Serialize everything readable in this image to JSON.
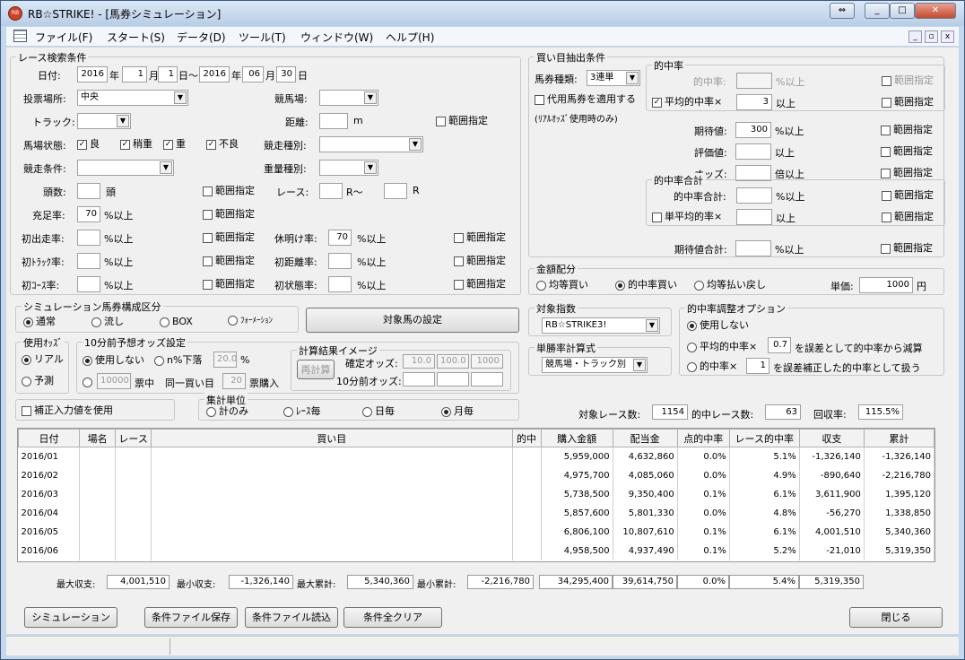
{
  "window": {
    "title": "RB☆STRIKE! - [馬券シミュレーション]",
    "app_icon": "RB"
  },
  "menu": [
    "ファイル(F)",
    "スタート(S)",
    "データ(D)",
    "ツール(T)",
    "ウィンドウ(W)",
    "ヘルプ(H)"
  ],
  "race": {
    "group": "レース検索条件",
    "date_label": "日付:",
    "y1": "2016",
    "y": "年",
    "m1": "1",
    "m": "月",
    "d1": "1",
    "d_range": "日～",
    "y2": "2016",
    "m2": "06",
    "d2": "30",
    "d": "日",
    "venue_label": "投票場所:",
    "venue": "中央",
    "track_label": "競馬場:",
    "course_label": "トラック:",
    "distance_label": "距離:",
    "distance_unit": "m",
    "range": "範囲指定",
    "condition_label": "馬場状態:",
    "cond_good": "良",
    "cond_slightly_heavy": "稍重",
    "cond_heavy": "重",
    "cond_bad": "不良",
    "type_label": "競走種別:",
    "race_cond_label": "競走条件:",
    "weight_label": "重量種別:",
    "heads_label": "頭数:",
    "heads_unit": "頭",
    "race_label": "レース:",
    "race_from_unit": "R～",
    "race_to_unit": "R",
    "fill_label": "充足率:",
    "fill_value": "70",
    "pct_over": "%以上",
    "first_run_label": "初出走率:",
    "layoff_label": "休明け率:",
    "layoff_value": "70",
    "first_track_label": "初ﾄﾗｯｸ率:",
    "first_dist_label": "初距離率:",
    "first_course_label": "初ｺｰｽ率:",
    "first_cond_label": "初状態率:"
  },
  "sim_comp": {
    "group": "シミュレーション馬券構成区分",
    "options": [
      "通常",
      "流し",
      "BOX",
      "ﾌｫｰﾒｰｼｮﾝ"
    ],
    "selected": 0,
    "target_btn": "対象馬の設定"
  },
  "odds_use": {
    "group": "使用ｵｯｽﾞ",
    "options": [
      "リアル",
      "予測"
    ],
    "selected": 0
  },
  "odds10": {
    "group": "10分前予想オッズ設定",
    "unused": "使用しない",
    "drop_label": "n%下落",
    "drop_value": "20.0",
    "drop_unit": "%",
    "amount": "10000",
    "in_label": "票中",
    "same_label": "同一買い目",
    "same_value": "20",
    "buy_label": "票購入"
  },
  "calc_img": {
    "group": "計算結果イメージ",
    "recalc": "再計算",
    "confirmed_label": "確定オッズ:",
    "confirmed": [
      "10.0",
      "100.0",
      "1000"
    ],
    "before_label": "10分前オッズ:"
  },
  "correction": "補正入力値を使用",
  "agg": {
    "group": "集計単位",
    "options": [
      "計のみ",
      "ﾚｰｽ毎",
      "日毎",
      "月毎"
    ],
    "selected": 3
  },
  "buy": {
    "group": "買い目抽出条件",
    "ticket_label": "馬券種類:",
    "ticket": "3連単",
    "substitute": "代用馬券を適用する",
    "substitute_note": "(ﾘｱﾙｵｯｽﾞ使用時のみ)",
    "hit_group": "的中率",
    "hit_label": "的中率:",
    "hit_unit": "%以上",
    "avg_hit_label": "平均的中率×",
    "avg_hit_value": "3",
    "over": "以上",
    "range": "範囲指定",
    "exp_label": "期待値:",
    "exp_value": "300",
    "exp_unit": "%以上",
    "eval_label": "評価値:",
    "eval_unit": "以上",
    "odds_label": "オッズ:",
    "odds_unit": "倍以上",
    "hit_total_group": "的中率合計",
    "hit_total_label": "的中率合計:",
    "hit_total_unit": "%以上",
    "single_avg_label": "単平均的率×",
    "single_avg_unit": "以上",
    "exp_total_label": "期待値合計:",
    "exp_total_unit": "%以上"
  },
  "money": {
    "group": "金額配分",
    "options": [
      "均等買い",
      "的中率買い",
      "均等払い戻し"
    ],
    "selected": 1,
    "unit_label": "単価:",
    "unit_value": "1000",
    "unit": "円"
  },
  "target_index": {
    "group": "対象指数",
    "value": "RB☆STRIKE3!"
  },
  "win_calc": {
    "group": "単勝率計算式",
    "value": "競馬場・トラック別"
  },
  "adjust": {
    "group": "的中率調整オプション",
    "unused": "使用しない",
    "opt2_pre": "平均的中率×",
    "opt2_val": "0.7",
    "opt2_post": "を誤差として的中率から減算",
    "opt3_pre": "的中率×",
    "opt3_val": "1",
    "opt3_post": "を誤差補正した的中率として扱う",
    "selected": 0
  },
  "stats": {
    "races_label": "対象レース数:",
    "races": "1154",
    "hits_label": "的中レース数:",
    "hits": "63",
    "recovery_label": "回収率:",
    "recovery": "115.5%"
  },
  "table": {
    "headers": [
      "日付",
      "場名",
      "レース",
      "買い目",
      "的中",
      "購入金額",
      "配当金",
      "点的中率",
      "レース的中率",
      "収支",
      "累計"
    ],
    "rows": [
      [
        "2016/01",
        "",
        "",
        "",
        "",
        "5,959,000",
        "4,632,860",
        "0.0%",
        "5.1%",
        "-1,326,140",
        "-1,326,140"
      ],
      [
        "2016/02",
        "",
        "",
        "",
        "",
        "4,975,700",
        "4,085,060",
        "0.0%",
        "4.9%",
        "-890,640",
        "-2,216,780"
      ],
      [
        "2016/03",
        "",
        "",
        "",
        "",
        "5,738,500",
        "9,350,400",
        "0.1%",
        "6.1%",
        "3,611,900",
        "1,395,120"
      ],
      [
        "2016/04",
        "",
        "",
        "",
        "",
        "5,857,600",
        "5,801,330",
        "0.0%",
        "4.8%",
        "-56,270",
        "1,338,850"
      ],
      [
        "2016/05",
        "",
        "",
        "",
        "",
        "6,806,100",
        "10,807,610",
        "0.1%",
        "6.1%",
        "4,001,510",
        "5,340,360"
      ],
      [
        "2016/06",
        "",
        "",
        "",
        "",
        "4,958,500",
        "4,937,490",
        "0.1%",
        "5.2%",
        "-21,010",
        "5,319,350"
      ]
    ]
  },
  "summary": {
    "max_label": "最大収支:",
    "max": "4,001,510",
    "min_label": "最小収支:",
    "min": "-1,326,140",
    "max_cum_label": "最大累計:",
    "max_cum": "5,340,360",
    "min_cum_label": "最小累計:",
    "min_cum": "-2,216,780",
    "buy": "34,295,400",
    "pay": "39,614,750",
    "pt_hit": "0.0%",
    "race_hit": "5.4%",
    "cum": "5,319,350"
  },
  "buttons": {
    "simulate": "シミュレーション",
    "save": "条件ファイル保存",
    "load": "条件ファイル読込",
    "clear": "条件全クリア",
    "close": "閉じる"
  }
}
